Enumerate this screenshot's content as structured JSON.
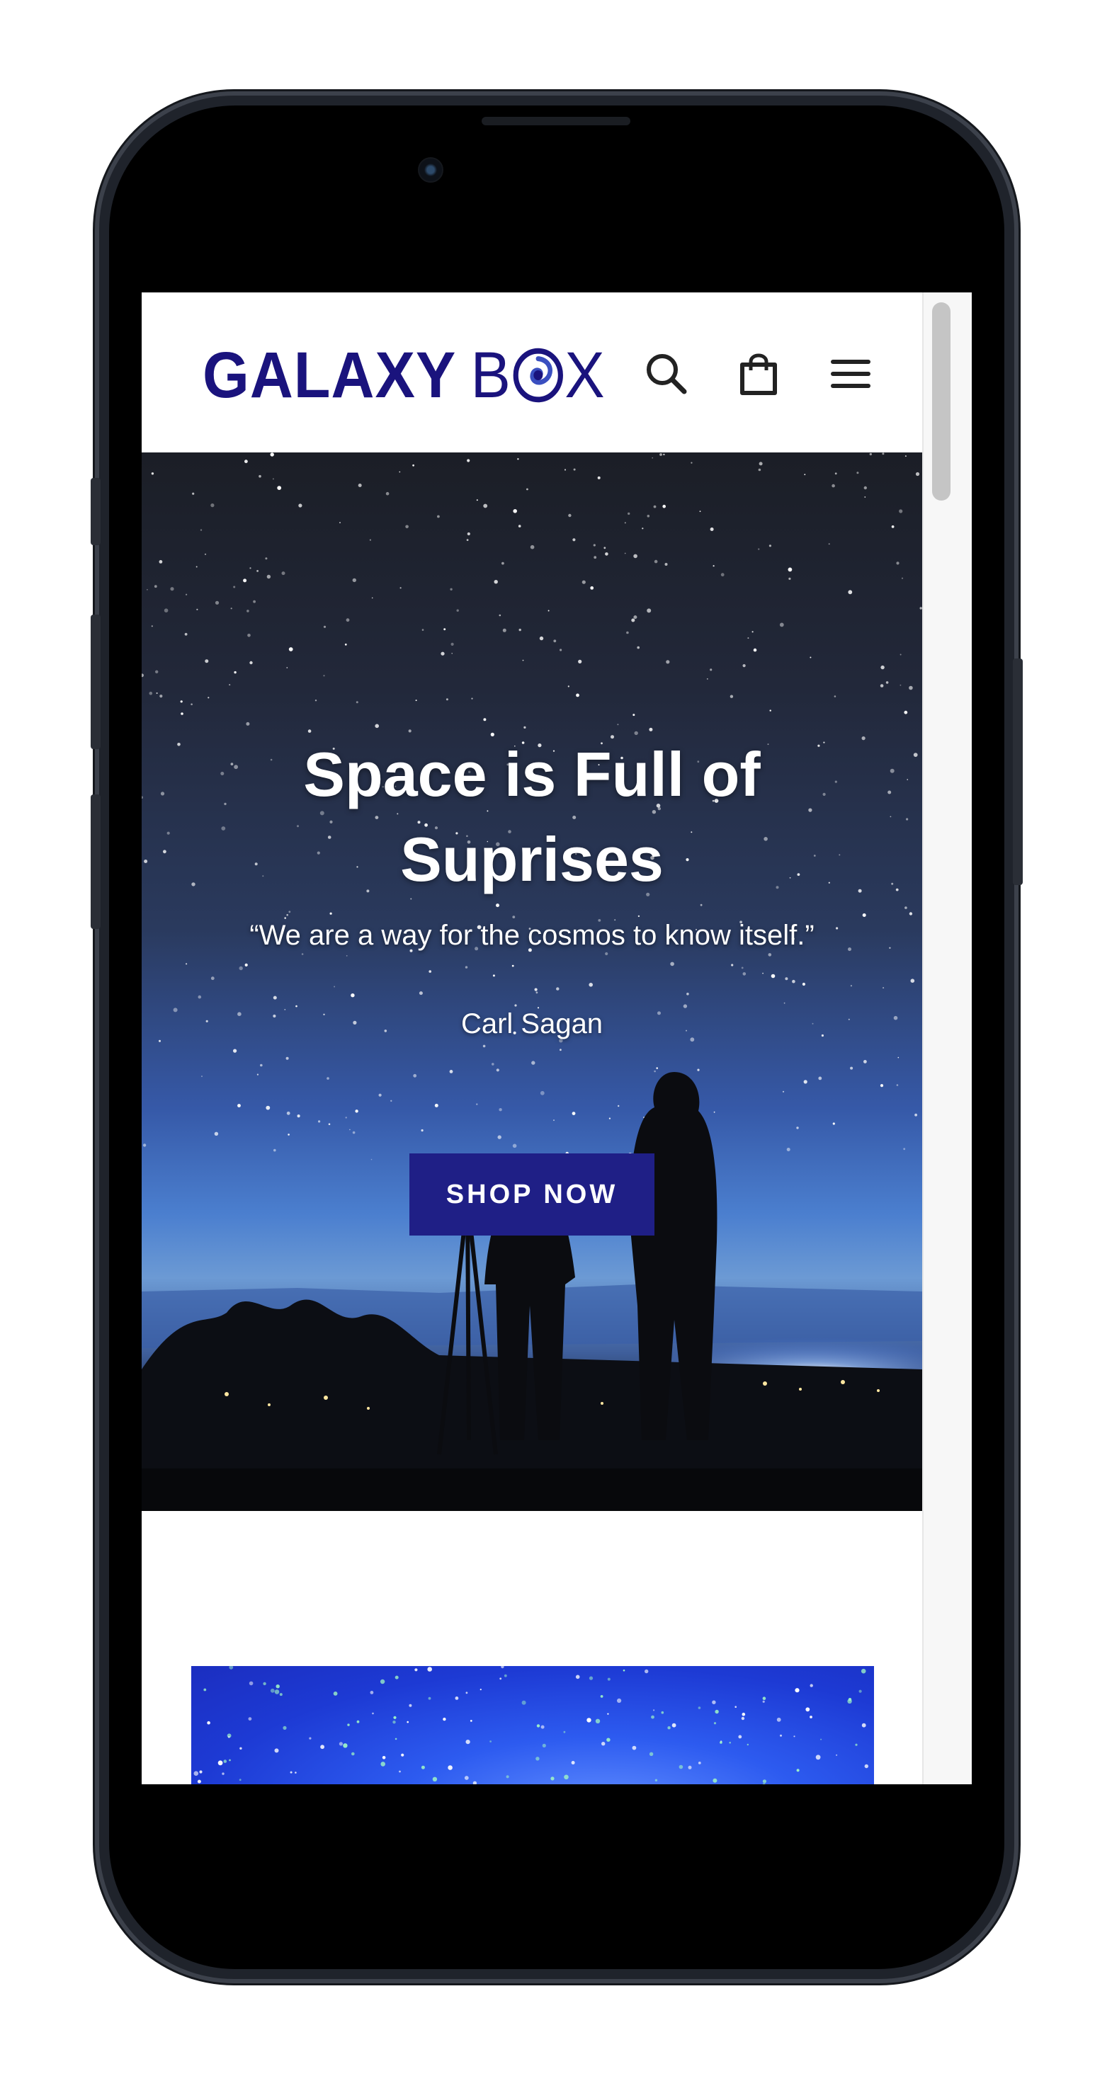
{
  "brand": {
    "logo_text_left": "GALAXY",
    "logo_text_b": "B",
    "logo_text_x": "X",
    "color": "#1a137d"
  },
  "header": {
    "icons": [
      "search-icon",
      "cart-icon",
      "menu-icon"
    ]
  },
  "hero": {
    "title_line1": "Space is Full of",
    "title_line2": "Suprises",
    "quote": "“We are a way for the cosmos to know itself.”",
    "author": "Carl Sagan",
    "cta_label": "SHOP NOW",
    "cta_color": "#1f1f86"
  }
}
